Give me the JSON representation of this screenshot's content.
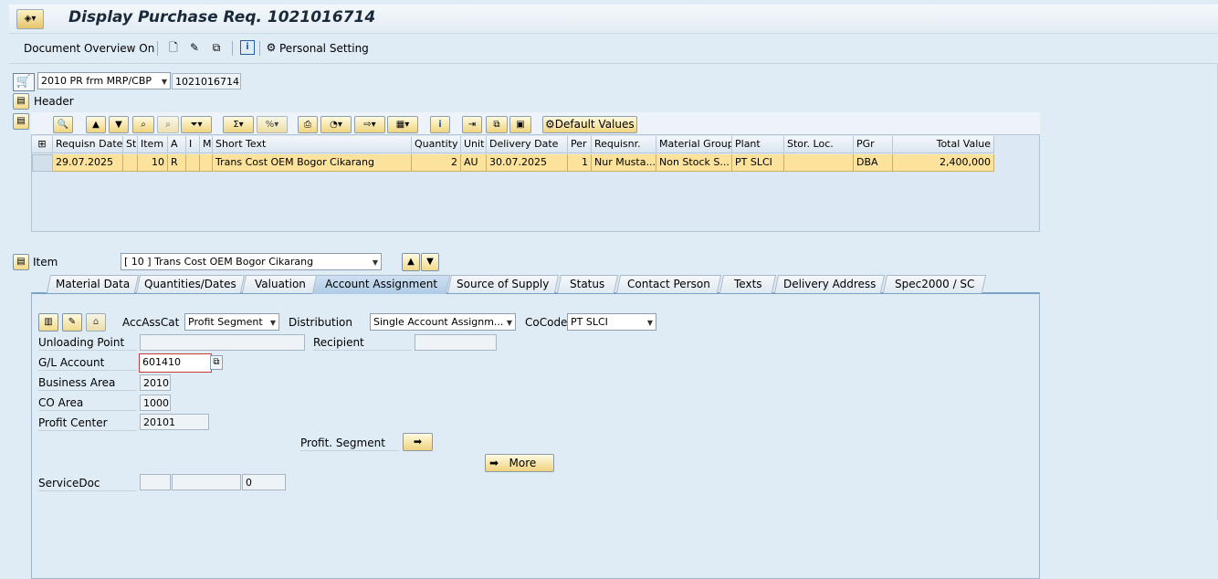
{
  "title": "Display Purchase Req. 1021016714",
  "toolbar": {
    "doc_overview": "Document Overview On",
    "personal_setting": "Personal Setting"
  },
  "header_bar": {
    "doc_type": "2010 PR frm MRP/CBP",
    "doc_number": "1021016714",
    "header_label": "Header"
  },
  "grid": {
    "default_values": "Default Values",
    "columns": [
      "Requisn Date",
      "St",
      "Item",
      "A",
      "I",
      "Ma",
      "Short Text",
      "Quantity",
      "Unit",
      "Delivery Date",
      "Per",
      "Requisnr.",
      "Material Group",
      "Plant",
      "Stor. Loc.",
      "PGr",
      "Total Value"
    ],
    "row": {
      "requisn_date": "29.07.2025",
      "st": "",
      "item": "10",
      "a": "R",
      "i": "",
      "ma": "",
      "short_text": "Trans Cost OEM Bogor Cikarang",
      "quantity": "2",
      "unit": "AU",
      "delivery_date": "30.07.2025",
      "per": "1",
      "requisnr": "Nur Musta...",
      "material_group": "Non Stock S...",
      "plant": "PT SLCI",
      "stor_loc": "",
      "pgr": "DBA",
      "total_value": "2,400,000"
    }
  },
  "item": {
    "label": "Item",
    "selected": "[ 10 ] Trans Cost OEM Bogor Cikarang"
  },
  "tabs": [
    "Material Data",
    "Quantities/Dates",
    "Valuation",
    "Account Assignment",
    "Source of Supply",
    "Status",
    "Contact Person",
    "Texts",
    "Delivery Address",
    "Spec2000 / SC"
  ],
  "active_tab": "Account Assignment",
  "account": {
    "accasscat_label": "AccAssCat",
    "accasscat_value": "Profit Segment",
    "distribution_label": "Distribution",
    "distribution_value": "Single Account Assignm...",
    "cocode_label": "CoCode",
    "cocode_value": "PT SLCI",
    "unloading_label": "Unloading Point",
    "unloading_value": "",
    "recipient_label": "Recipient",
    "recipient_value": "",
    "gl_label": "G/L Account",
    "gl_value": "601410",
    "ba_label": "Business Area",
    "ba_value": "2010",
    "coarea_label": "CO Area",
    "coarea_value": "1000",
    "pc_label": "Profit Center",
    "pc_value": "20101",
    "profseg_label": "Profit. Segment",
    "more_label": "More",
    "servicedoc_label": "ServiceDoc",
    "servicedoc_v1": "",
    "servicedoc_v2": "",
    "servicedoc_v3": "0"
  }
}
